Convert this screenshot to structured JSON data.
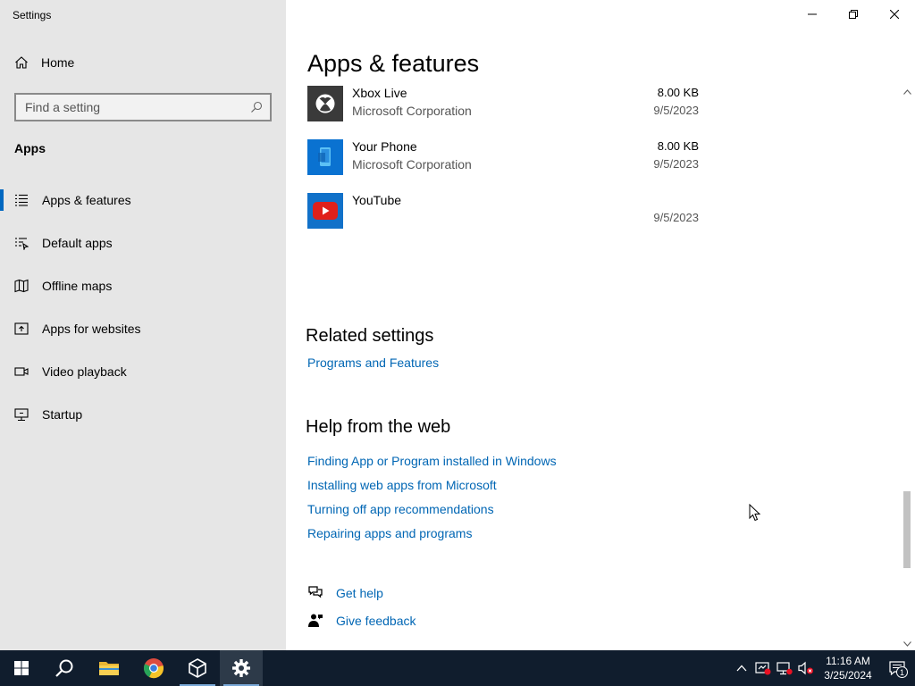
{
  "window": {
    "title": "Settings"
  },
  "sidebar": {
    "home_label": "Home",
    "search_placeholder": "Find a setting",
    "section": "Apps",
    "items": [
      {
        "label": "Apps & features",
        "icon": "list-icon",
        "active": true
      },
      {
        "label": "Default apps",
        "icon": "default-apps-icon",
        "active": false
      },
      {
        "label": "Offline maps",
        "icon": "map-icon",
        "active": false
      },
      {
        "label": "Apps for websites",
        "icon": "web-app-icon",
        "active": false
      },
      {
        "label": "Video playback",
        "icon": "video-icon",
        "active": false
      },
      {
        "label": "Startup",
        "icon": "startup-icon",
        "active": false
      }
    ]
  },
  "main": {
    "title": "Apps & features",
    "apps": [
      {
        "name": "Xbox Live",
        "publisher": "Microsoft Corporation",
        "size": "8.00 KB",
        "date": "9/5/2023",
        "icon": "xbox-icon",
        "tile_color": "#3a3a3a"
      },
      {
        "name": "Your Phone",
        "publisher": "Microsoft Corporation",
        "size": "8.00 KB",
        "date": "9/5/2023",
        "icon": "phone-icon",
        "tile_color": "#0a72d1"
      },
      {
        "name": "YouTube",
        "publisher": "",
        "size": "",
        "date": "9/5/2023",
        "icon": "youtube-icon",
        "tile_color": "#1171c9"
      }
    ],
    "related": {
      "heading": "Related settings",
      "links": [
        "Programs and Features"
      ]
    },
    "help": {
      "heading": "Help from the web",
      "links": [
        "Finding App or Program installed in Windows",
        "Installing web apps from Microsoft",
        "Turning off app recommendations",
        "Repairing apps and programs"
      ]
    },
    "get_help": "Get help",
    "give_feedback": "Give feedback",
    "scroll_position": 0.85
  },
  "taskbar": {
    "time": "11:16 AM",
    "date": "3/25/2024",
    "notification_count": "1"
  },
  "colors": {
    "accent": "#0067c0",
    "link": "#0066b4",
    "sidebar_bg": "#e6e6e6",
    "taskbar_bg": "#101d2d"
  }
}
